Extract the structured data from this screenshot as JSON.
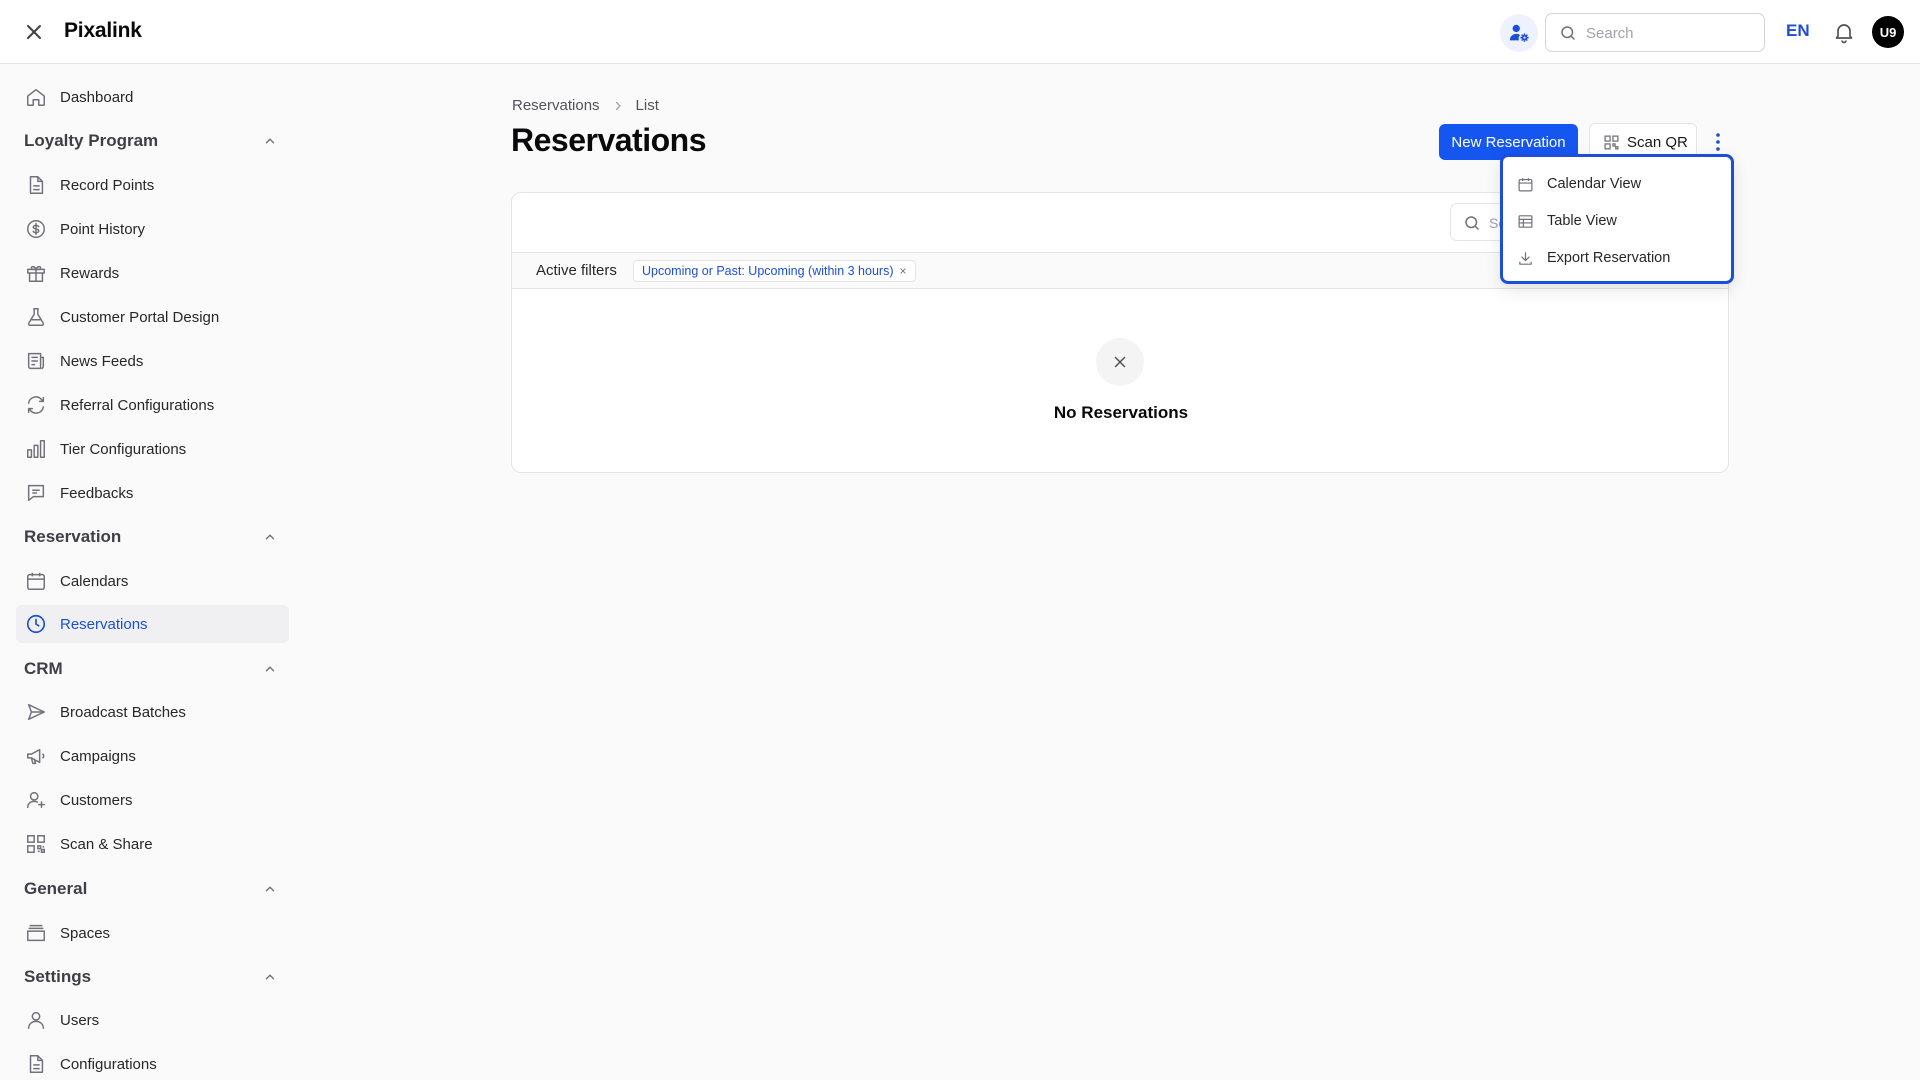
{
  "app": {
    "title": "Pixalink"
  },
  "header": {
    "search_placeholder": "Search",
    "language": "EN",
    "avatar_initials": "U9",
    "accent_color": "#1d4ed8"
  },
  "sidebar": {
    "items": {
      "dashboard": {
        "label": "Dashboard",
        "icon": "home-icon"
      }
    },
    "sections": [
      {
        "label": "Loyalty Program",
        "items": [
          {
            "label": "Record Points",
            "icon": "document-icon"
          },
          {
            "label": "Point History",
            "icon": "dollar-circle-icon"
          },
          {
            "label": "Rewards",
            "icon": "gift-icon"
          },
          {
            "label": "Customer Portal Design",
            "icon": "flask-icon"
          },
          {
            "label": "News Feeds",
            "icon": "newspaper-icon"
          },
          {
            "label": "Referral Configurations",
            "icon": "refresh-icon"
          },
          {
            "label": "Tier Configurations",
            "icon": "bar-chart-icon"
          },
          {
            "label": "Feedbacks",
            "icon": "message-icon"
          }
        ]
      },
      {
        "label": "Reservation",
        "items": [
          {
            "label": "Calendars",
            "icon": "calendar-icon"
          },
          {
            "label": "Reservations",
            "icon": "clock-icon",
            "active": true
          }
        ]
      },
      {
        "label": "CRM",
        "items": [
          {
            "label": "Broadcast Batches",
            "icon": "send-icon"
          },
          {
            "label": "Campaigns",
            "icon": "megaphone-icon"
          },
          {
            "label": "Customers",
            "icon": "user-plus-icon"
          },
          {
            "label": "Scan & Share",
            "icon": "qr-code-icon"
          }
        ]
      },
      {
        "label": "General",
        "items": [
          {
            "label": "Spaces",
            "icon": "archive-icon"
          }
        ]
      },
      {
        "label": "Settings",
        "items": [
          {
            "label": "Users",
            "icon": "user-icon"
          },
          {
            "label": "Configurations",
            "icon": "document-icon"
          }
        ]
      }
    ]
  },
  "breadcrumb": [
    "Reservations",
    "List"
  ],
  "page": {
    "title": "Reservations",
    "new_button": "New Reservation",
    "scan_button": "Scan QR"
  },
  "card": {
    "search_placeholder": "Search",
    "filters_label": "Active filters",
    "filter_chip": "Upcoming or Past: Upcoming (within 3 hours)",
    "filter_chip_remove": "×",
    "empty_title": "No Reservations"
  },
  "menu": {
    "items": [
      {
        "label": "Calendar View",
        "icon": "calendar-icon"
      },
      {
        "label": "Table View",
        "icon": "table-icon"
      },
      {
        "label": "Export Reservation",
        "icon": "download-icon"
      }
    ]
  }
}
